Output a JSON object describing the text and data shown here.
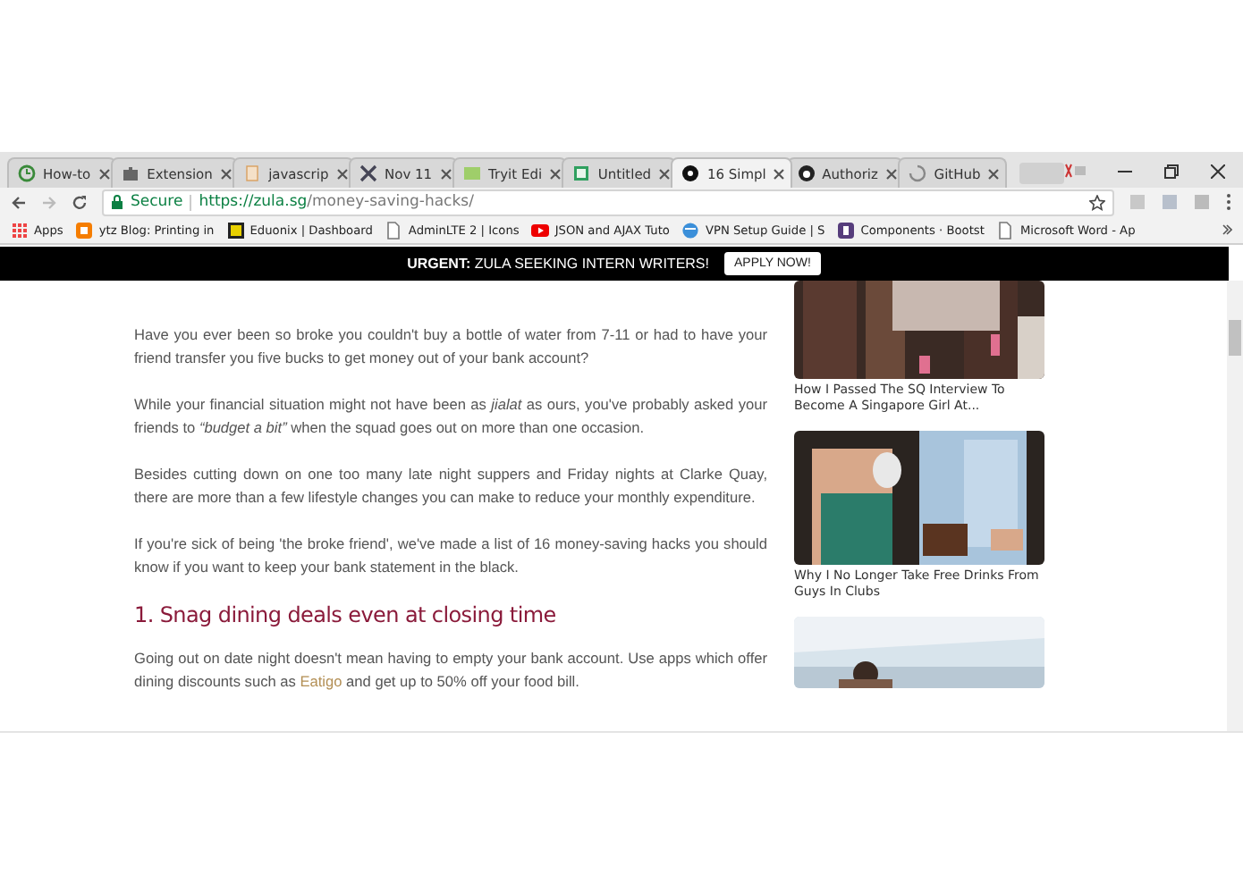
{
  "tabs": [
    {
      "label": "How-to",
      "selected": false
    },
    {
      "label": "Extension",
      "selected": false
    },
    {
      "label": "javascrip",
      "selected": false
    },
    {
      "label": "Nov 11",
      "selected": false
    },
    {
      "label": "Tryit Edi",
      "selected": false
    },
    {
      "label": "Untitled",
      "selected": false
    },
    {
      "label": "16 Simpl",
      "selected": true
    },
    {
      "label": "Authoriz",
      "selected": false
    },
    {
      "label": "GitHub",
      "selected": false
    }
  ],
  "address": {
    "secure_label": "Secure",
    "url_host": "https://zula.sg",
    "url_path": "/money-saving-hacks/"
  },
  "bookmarks": [
    "Apps",
    "ytz Blog: Printing in",
    "Eduonix | Dashboard",
    "AdminLTE 2 | Icons",
    "JSON and AJAX Tuto",
    "VPN Setup Guide | S",
    "Components · Bootst",
    "Microsoft Word - Ap"
  ],
  "banner": {
    "strong": "URGENT:",
    "text": "ZULA SEEKING INTERN WRITERS!",
    "button": "APPLY NOW!"
  },
  "article": {
    "blocks": [
      {
        "kind": "paragraph",
        "text": "Have you ever been so broke you couldn't buy a bottle of water from 7-11 or had to have your friend transfer you five bucks to get money out of your bank account?"
      },
      {
        "kind": "paragraph",
        "text": "While your financial situation might not have been as *jialat* as ours, you've probably asked your friends to *“budget a bit”* when the squad goes out on more than one occasion."
      },
      {
        "kind": "paragraph",
        "text": "Besides cutting down on one too many late night suppers and Friday nights at Clarke Quay, there are more than a few lifestyle changes you can make to reduce your monthly expenditure."
      },
      {
        "kind": "paragraph",
        "text": "If you're sick of being 'the broke friend', we've made a list of 16 money-saving hacks you should know if you want to keep your bank statement in the black."
      },
      {
        "kind": "heading",
        "text": "1. Snag dining deals even at closing time"
      },
      {
        "kind": "paragraph",
        "text": "Going out on date night doesn't mean having to empty your bank account. Use apps which offer dining discounts such as ",
        "link": "Eatigo",
        "after": " and get up to 50% off your food bill."
      }
    ]
  },
  "sidebar": [
    {
      "kind": "picture",
      "title": "How I Passed The SQ Interview To Become A Singapore Girl At..."
    },
    {
      "kind": "picture",
      "title": "Why I No Longer Take Free Drinks From Guys In Clubs"
    },
    {
      "kind": "picture"
    }
  ]
}
